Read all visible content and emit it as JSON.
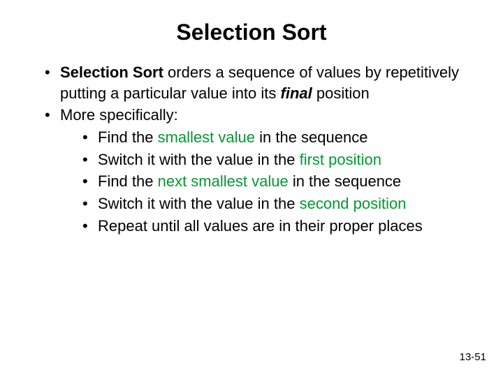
{
  "title": "Selection Sort",
  "bullet1": {
    "lead": "Selection Sort",
    "rest1": " orders a sequence of values by repetitively putting a particular value into its ",
    "final": "final",
    "rest2": " position"
  },
  "bullet2": {
    "lead": "More specifically:",
    "sub": [
      {
        "pre": "Find the ",
        "hl": "smallest value",
        "post": " in the sequence"
      },
      {
        "pre": "Switch it with the value in the ",
        "hl": "first position",
        "post": ""
      },
      {
        "pre": "Find the ",
        "hl": "next smallest value",
        "post": " in the sequence"
      },
      {
        "pre": "Switch it with the value in the ",
        "hl": "second position",
        "post": ""
      },
      {
        "pre": "Repeat until all values are in their proper places",
        "hl": "",
        "post": ""
      }
    ]
  },
  "pageNumber": "13-51"
}
